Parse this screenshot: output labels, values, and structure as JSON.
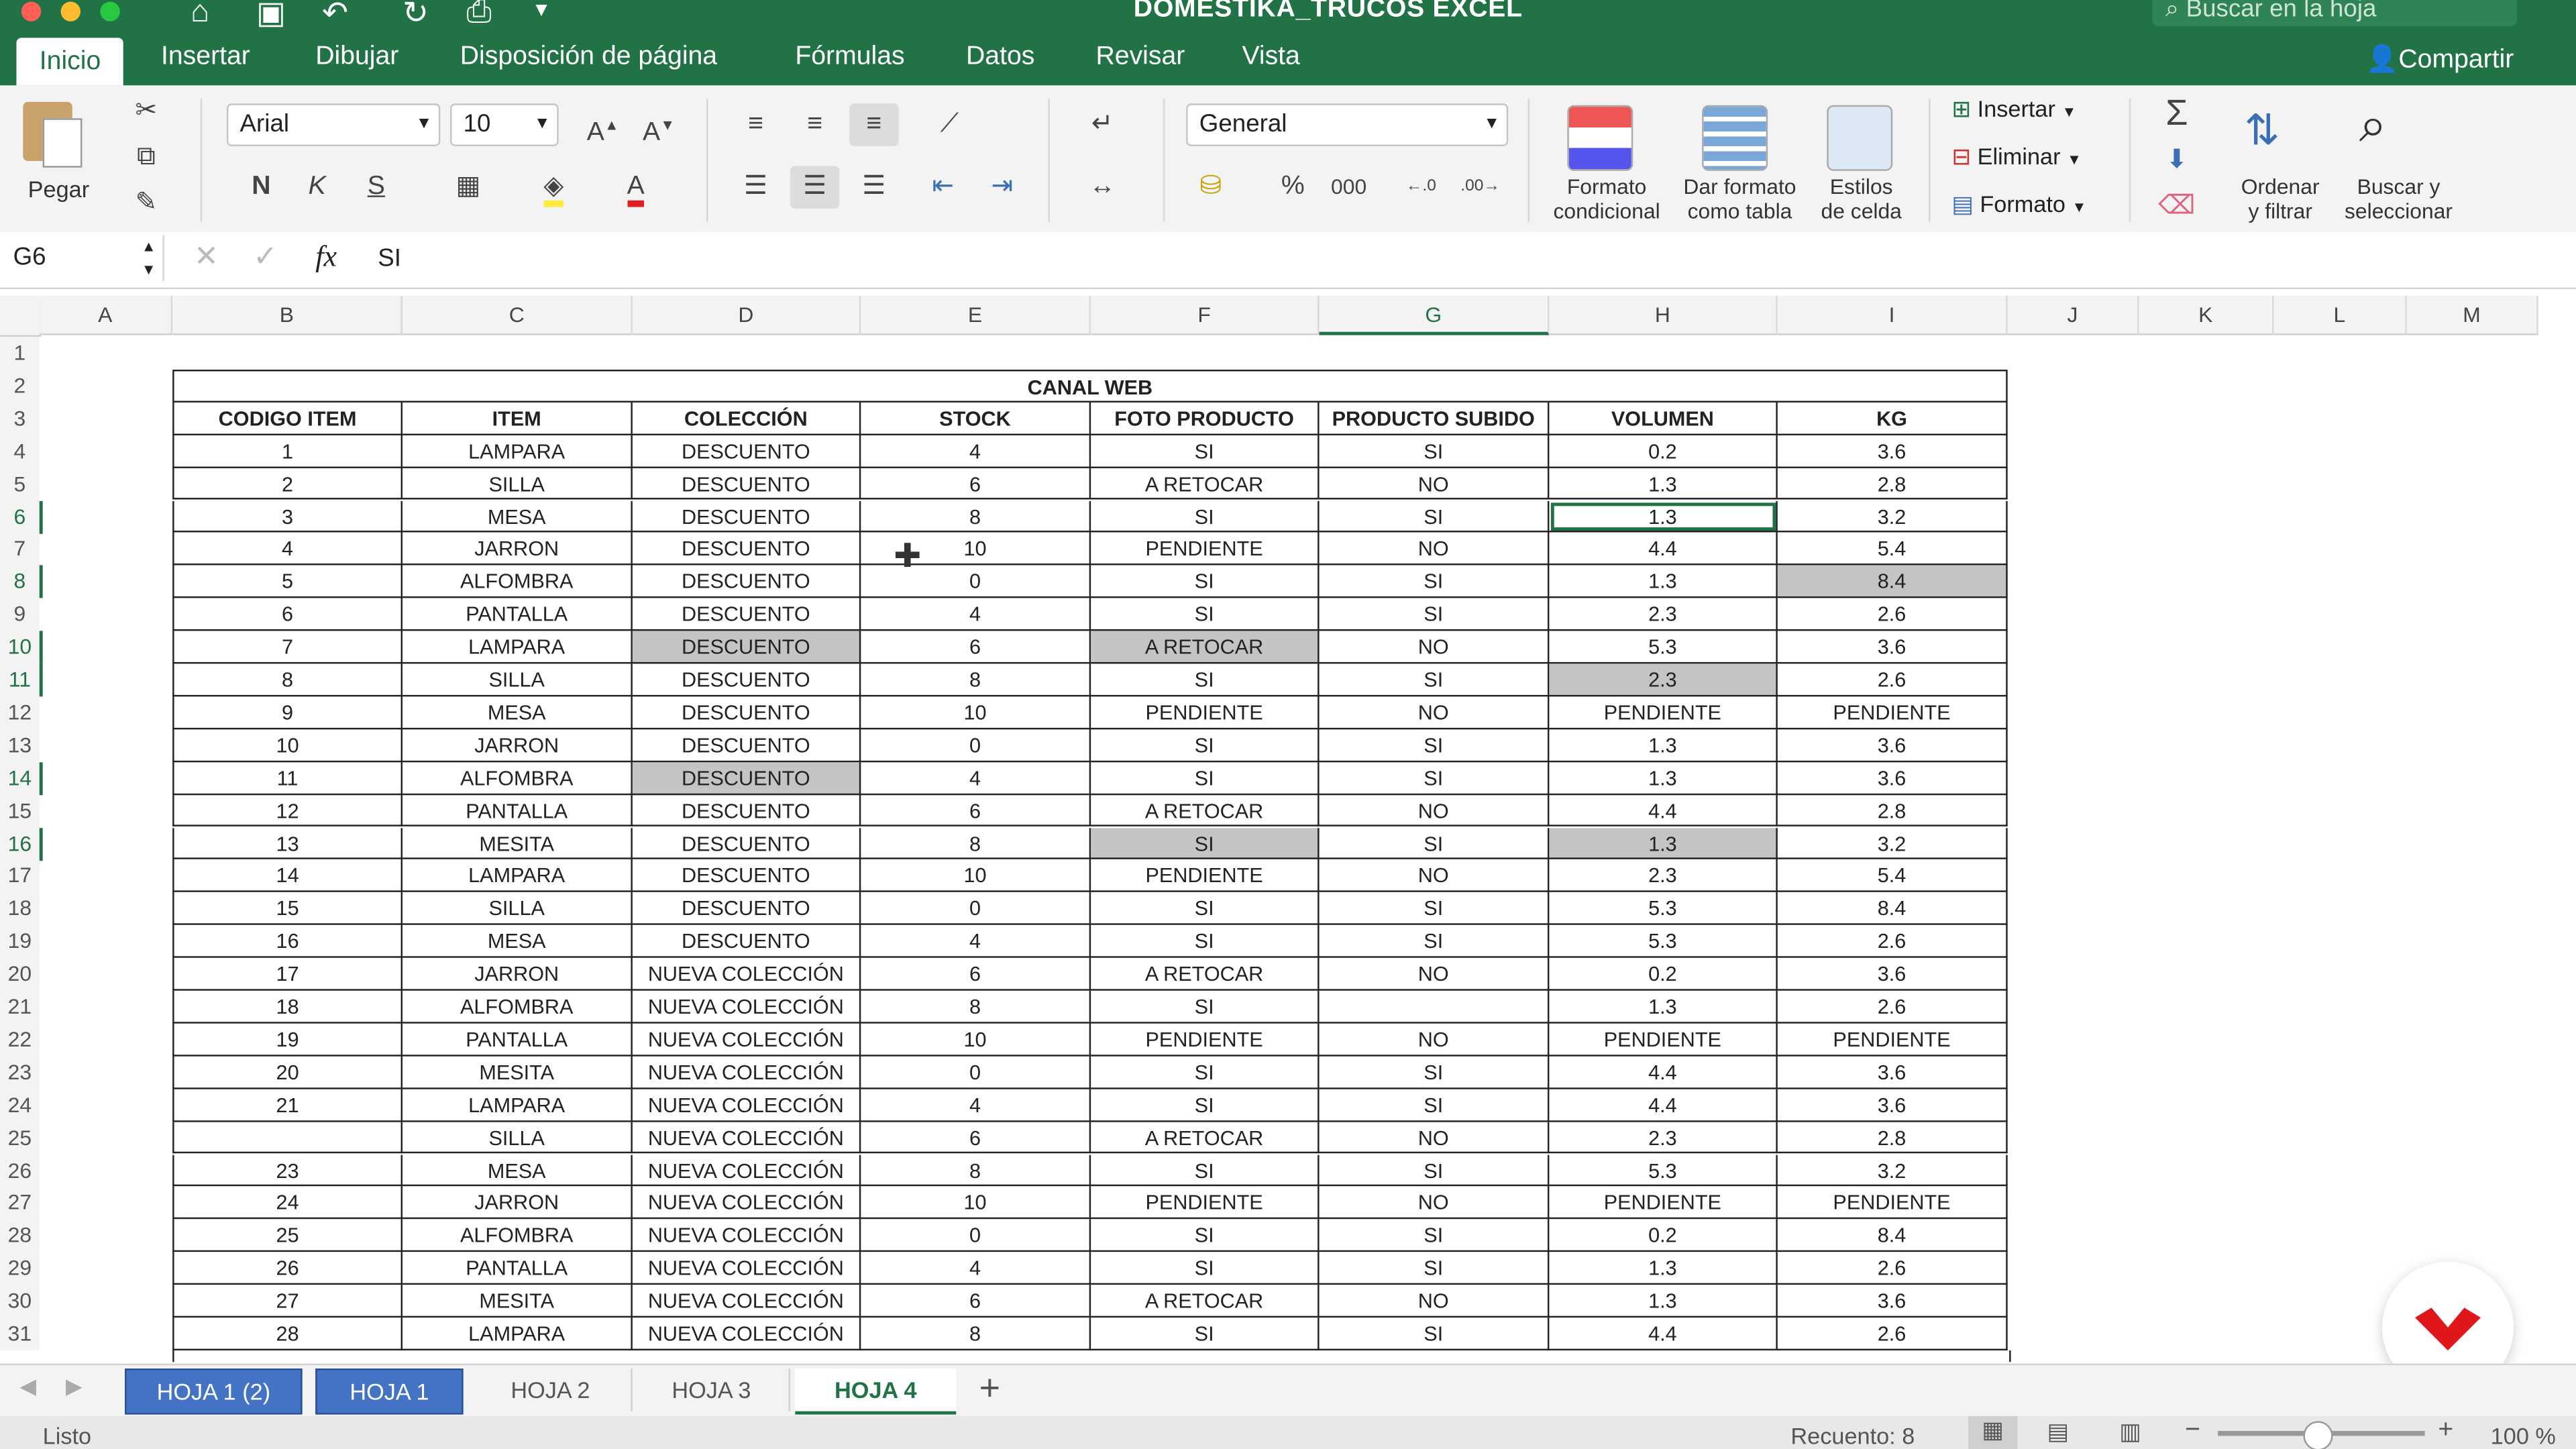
{
  "window": {
    "title": "DOMESTIKA_TRUCOS EXCEL",
    "search_placeholder": "Buscar en la hoja",
    "share_label": "Compartir"
  },
  "ribbon_tabs": [
    "Inicio",
    "Insertar",
    "Dibujar",
    "Disposición de página",
    "Fórmulas",
    "Datos",
    "Revisar",
    "Vista"
  ],
  "ribbon": {
    "paste_label": "Pegar",
    "font_name": "Arial",
    "font_size": "10",
    "bold": "N",
    "italic": "K",
    "underline": "S",
    "number_format": "General",
    "percent": "%",
    "thousands": "000",
    "cond_format_label_1": "Formato",
    "cond_format_label_2": "condicional",
    "table_format_label_1": "Dar formato",
    "table_format_label_2": "como tabla",
    "cell_styles_label_1": "Estilos",
    "cell_styles_label_2": "de celda",
    "insert_label": "Insertar",
    "delete_label": "Eliminar",
    "format_label": "Formato",
    "sort_label_1": "Ordenar",
    "sort_label_2": "y filtrar",
    "find_label_1": "Buscar y",
    "find_label_2": "seleccionar"
  },
  "formula_bar": {
    "name_box": "G6",
    "fx": "fx",
    "content": "SI"
  },
  "columns": [
    "A",
    "B",
    "C",
    "D",
    "E",
    "F",
    "G",
    "H",
    "I",
    "J",
    "K",
    "L",
    "M"
  ],
  "table": {
    "title": "CANAL WEB",
    "headers": [
      "CODIGO ITEM",
      "ITEM",
      "COLECCIÓN",
      "STOCK",
      "FOTO PRODUCTO",
      "PRODUCTO SUBIDO",
      "VOLUMEN",
      "KG"
    ],
    "rows": [
      [
        "1",
        "LAMPARA",
        "DESCUENTO",
        "4",
        "SI",
        "SI",
        "0.2",
        "3.6"
      ],
      [
        "2",
        "SILLA",
        "DESCUENTO",
        "6",
        "A RETOCAR",
        "NO",
        "1.3",
        "2.8"
      ],
      [
        "3",
        "MESA",
        "DESCUENTO",
        "8",
        "SI",
        "SI",
        "1.3",
        "3.2"
      ],
      [
        "4",
        "JARRON",
        "DESCUENTO",
        "10",
        "PENDIENTE",
        "NO",
        "4.4",
        "5.4"
      ],
      [
        "5",
        "ALFOMBRA",
        "DESCUENTO",
        "0",
        "SI",
        "SI",
        "1.3",
        "8.4"
      ],
      [
        "6",
        "PANTALLA",
        "DESCUENTO",
        "4",
        "SI",
        "SI",
        "2.3",
        "2.6"
      ],
      [
        "7",
        "LAMPARA",
        "DESCUENTO",
        "6",
        "A RETOCAR",
        "NO",
        "5.3",
        "3.6"
      ],
      [
        "8",
        "SILLA",
        "DESCUENTO",
        "8",
        "SI",
        "SI",
        "2.3",
        "2.6"
      ],
      [
        "9",
        "MESA",
        "DESCUENTO",
        "10",
        "PENDIENTE",
        "NO",
        "PENDIENTE",
        "PENDIENTE"
      ],
      [
        "10",
        "JARRON",
        "DESCUENTO",
        "0",
        "SI",
        "SI",
        "1.3",
        "3.6"
      ],
      [
        "11",
        "ALFOMBRA",
        "DESCUENTO",
        "4",
        "SI",
        "SI",
        "1.3",
        "3.6"
      ],
      [
        "12",
        "PANTALLA",
        "DESCUENTO",
        "6",
        "A RETOCAR",
        "NO",
        "4.4",
        "2.8"
      ],
      [
        "13",
        "MESITA",
        "DESCUENTO",
        "8",
        "SI",
        "SI",
        "1.3",
        "3.2"
      ],
      [
        "14",
        "LAMPARA",
        "DESCUENTO",
        "10",
        "PENDIENTE",
        "NO",
        "2.3",
        "5.4"
      ],
      [
        "15",
        "SILLA",
        "DESCUENTO",
        "0",
        "SI",
        "SI",
        "5.3",
        "8.4"
      ],
      [
        "16",
        "MESA",
        "DESCUENTO",
        "4",
        "SI",
        "SI",
        "5.3",
        "2.6"
      ],
      [
        "17",
        "JARRON",
        "NUEVA COLECCIÓN",
        "6",
        "A RETOCAR",
        "NO",
        "0.2",
        "3.6"
      ],
      [
        "18",
        "ALFOMBRA",
        "NUEVA COLECCIÓN",
        "8",
        "SI",
        "",
        "1.3",
        "2.6"
      ],
      [
        "19",
        "PANTALLA",
        "NUEVA COLECCIÓN",
        "10",
        "PENDIENTE",
        "NO",
        "PENDIENTE",
        "PENDIENTE"
      ],
      [
        "20",
        "MESITA",
        "NUEVA COLECCIÓN",
        "0",
        "SI",
        "SI",
        "4.4",
        "3.6"
      ],
      [
        "21",
        "LAMPARA",
        "NUEVA COLECCIÓN",
        "4",
        "SI",
        "SI",
        "4.4",
        "3.6"
      ],
      [
        "",
        "SILLA",
        "NUEVA COLECCIÓN",
        "6",
        "A RETOCAR",
        "NO",
        "2.3",
        "2.8"
      ],
      [
        "23",
        "MESA",
        "NUEVA COLECCIÓN",
        "8",
        "SI",
        "SI",
        "5.3",
        "3.2"
      ],
      [
        "24",
        "JARRON",
        "NUEVA COLECCIÓN",
        "10",
        "PENDIENTE",
        "NO",
        "PENDIENTE",
        "PENDIENTE"
      ],
      [
        "25",
        "ALFOMBRA",
        "NUEVA COLECCIÓN",
        "0",
        "SI",
        "SI",
        "0.2",
        "8.4"
      ],
      [
        "26",
        "PANTALLA",
        "NUEVA COLECCIÓN",
        "4",
        "SI",
        "SI",
        "1.3",
        "2.6"
      ],
      [
        "27",
        "MESITA",
        "NUEVA COLECCIÓN",
        "6",
        "A RETOCAR",
        "NO",
        "1.3",
        "3.6"
      ],
      [
        "28",
        "LAMPARA",
        "NUEVA COLECCIÓN",
        "8",
        "SI",
        "SI",
        "4.4",
        "2.6"
      ]
    ],
    "highlighted_cells": [
      [
        4,
        8
      ],
      [
        6,
        3
      ],
      [
        6,
        5
      ],
      [
        7,
        7
      ],
      [
        10,
        3
      ],
      [
        12,
        5
      ],
      [
        12,
        7
      ]
    ],
    "selected_cell": [
      2,
      6
    ]
  },
  "sheet_tabs": [
    {
      "label": "HOJA 1 (2)",
      "style": "selected"
    },
    {
      "label": "HOJA 1",
      "style": "selected"
    },
    {
      "label": "HOJA 2",
      "style": "normal"
    },
    {
      "label": "HOJA 3",
      "style": "normal"
    },
    {
      "label": "HOJA 4",
      "style": "active"
    }
  ],
  "status": {
    "state": "Listo",
    "count": "Recuento: 8",
    "zoom": "100 %"
  },
  "colors": {
    "excel_green": "#217346",
    "selected_tab_blue": "#4472c4",
    "highlight_gray": "#c4c4c4",
    "logo_red": "#e0161b"
  }
}
